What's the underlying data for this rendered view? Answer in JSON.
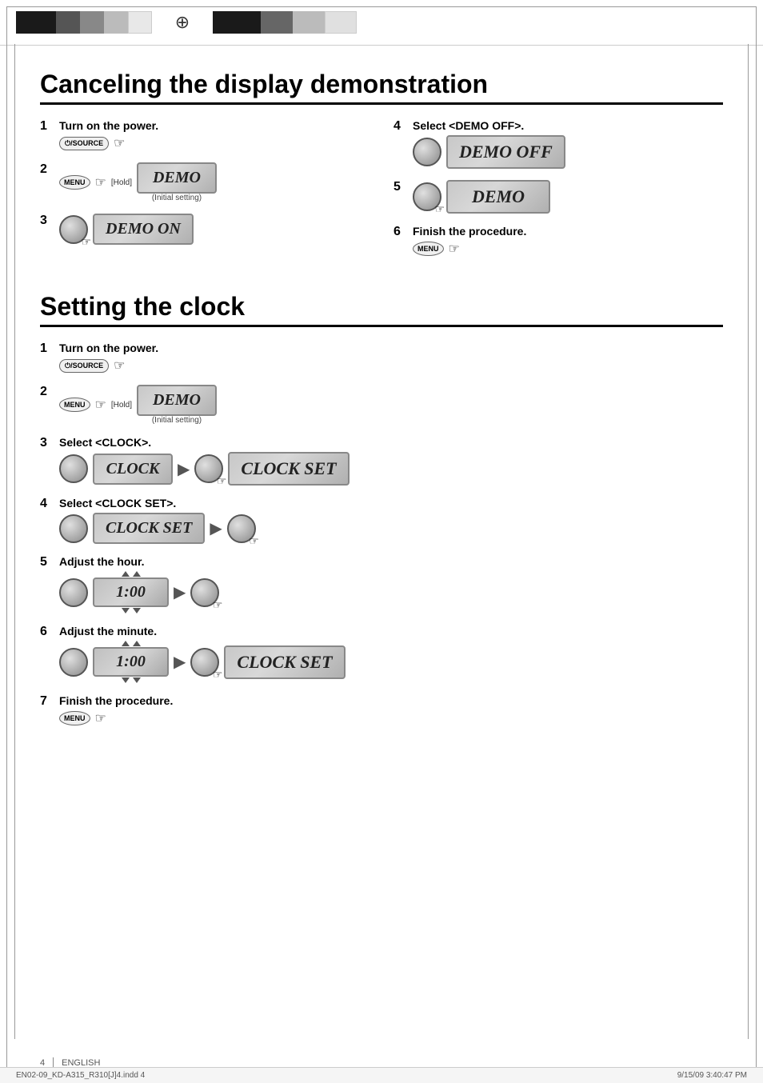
{
  "page": {
    "number": "4",
    "language": "ENGLISH",
    "print_info": "EN02-09_KD-A315_R310[J]4.indd   4",
    "print_date": "9/15/09   3:40:47 PM"
  },
  "section1": {
    "title": "Canceling the display demonstration",
    "steps": [
      {
        "num": "1",
        "label": "Turn on the power.",
        "source_btn": "⏻/SOURCE"
      },
      {
        "num": "2",
        "label": "",
        "hold": "[Hold]",
        "display": "DEMO",
        "caption": "(Initial setting)"
      },
      {
        "num": "3",
        "label": "",
        "display": "DEMO ON"
      },
      {
        "num": "4",
        "label": "Select <DEMO OFF>.",
        "display": "DEMO OFF"
      },
      {
        "num": "5",
        "label": "",
        "display": "DEMO"
      },
      {
        "num": "6",
        "label": "Finish the procedure.",
        "menu_btn": "MENU"
      }
    ]
  },
  "section2": {
    "title": "Setting the clock",
    "steps": [
      {
        "num": "1",
        "label": "Turn on the power.",
        "source_btn": "⏻/SOURCE"
      },
      {
        "num": "2",
        "label": "",
        "hold": "[Hold]",
        "display": "DEMO",
        "caption": "(Initial setting)"
      },
      {
        "num": "3",
        "label": "Select <CLOCK>.",
        "display1": "CLOCK",
        "display2": "CLOCK SET"
      },
      {
        "num": "4",
        "label": "Select <CLOCK SET>.",
        "display1": "CLOCK SET"
      },
      {
        "num": "5",
        "label": "Adjust the hour.",
        "display1": "1:00"
      },
      {
        "num": "6",
        "label": "Adjust the minute.",
        "display1": "1:00",
        "display2": "CLOCK SET"
      },
      {
        "num": "7",
        "label": "Finish the procedure.",
        "menu_btn": "MENU"
      }
    ]
  }
}
